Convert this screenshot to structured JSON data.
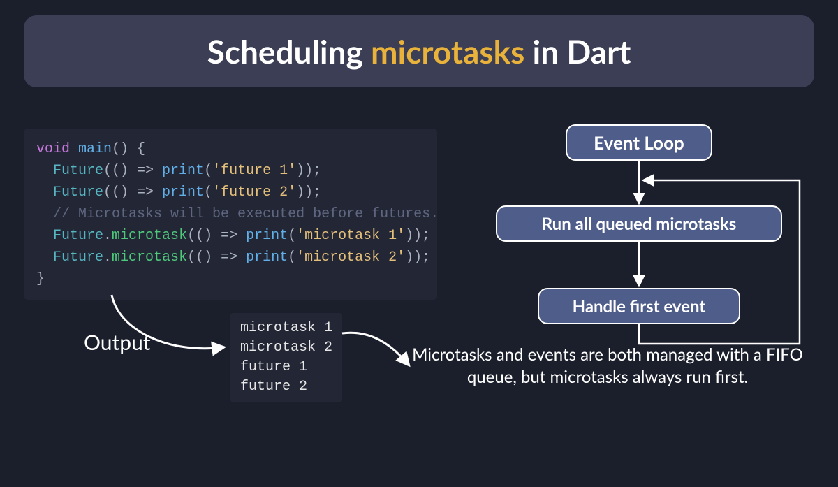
{
  "title": {
    "pre": "Scheduling ",
    "hl": "microtasks",
    "post": " in Dart"
  },
  "code": {
    "kw_void": "void",
    "fn_main": "main",
    "open": "() {",
    "type_future": "Future",
    "lambda_open": "(() => ",
    "fn_print": "print",
    "str_f1": "'future 1'",
    "str_f2": "'future 2'",
    "close_call": "));",
    "cmt": "// Microtasks will be executed before futures.",
    "meth_micro": "microtask",
    "str_m1": "'microtask 1'",
    "str_m2": "'microtask 2'",
    "brace_close": "}",
    "dot": ".",
    "paren_open": "(",
    "paren_close": ")"
  },
  "output_label": "Output",
  "output_lines": "microtask 1\nmicrotask 2\nfuture 1\nfuture 2",
  "footnote": "Microtasks and events are both managed with a FIFO queue, but microtasks always run first.",
  "flow": {
    "b1": "Event Loop",
    "b2": "Run all queued microtasks",
    "b3": "Handle first event"
  }
}
